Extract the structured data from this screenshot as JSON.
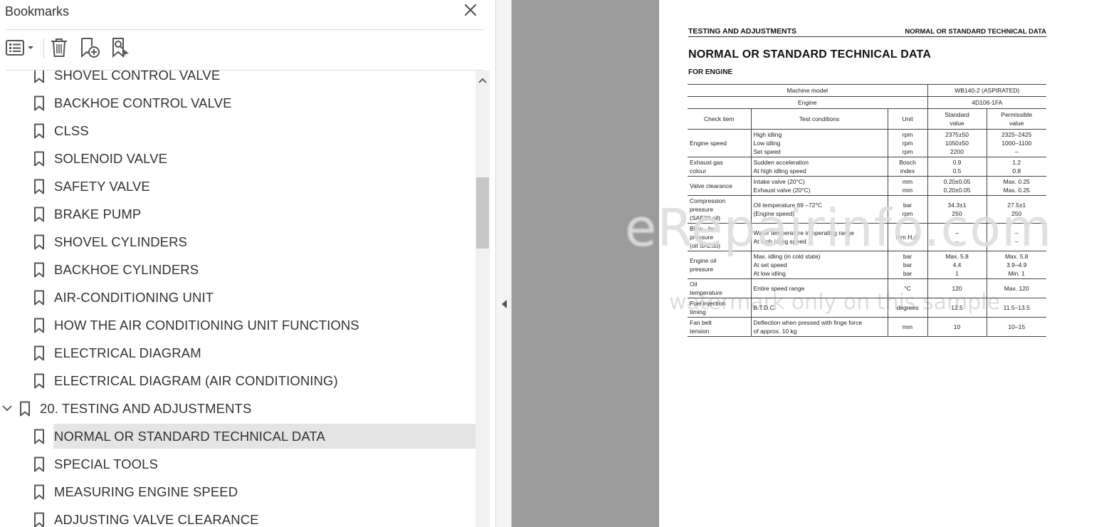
{
  "panel": {
    "title": "Bookmarks",
    "close_icon": "close-icon",
    "toolbar": {
      "options_icon": "list-options-icon",
      "delete_icon": "trash-icon",
      "new_bookmark_icon": "new-bookmark-icon",
      "find_bookmark_icon": "find-current-bookmark-icon"
    }
  },
  "bookmarks": [
    {
      "label": "SHOVEL CONTROL VALVE",
      "level": "child"
    },
    {
      "label": "BACKHOE CONTROL VALVE",
      "level": "child"
    },
    {
      "label": "CLSS",
      "level": "child"
    },
    {
      "label": "SOLENOID VALVE",
      "level": "child"
    },
    {
      "label": "SAFETY VALVE",
      "level": "child"
    },
    {
      "label": "BRAKE PUMP",
      "level": "child"
    },
    {
      "label": "SHOVEL CYLINDERS",
      "level": "child"
    },
    {
      "label": "BACKHOE CYLINDERS",
      "level": "child"
    },
    {
      "label": "AIR-CONDITIONING UNIT",
      "level": "child"
    },
    {
      "label": "HOW THE AIR CONDITIONING UNIT FUNCTIONS",
      "level": "child"
    },
    {
      "label": "ELECTRICAL DIAGRAM",
      "level": "child"
    },
    {
      "label": "ELECTRICAL DIAGRAM (AIR CONDITIONING)",
      "level": "child"
    },
    {
      "label": "20. TESTING AND ADJUSTMENTS",
      "level": "parent",
      "expanded": true
    },
    {
      "label": "NORMAL OR STANDARD TECHNICAL DATA",
      "level": "child",
      "selected": true
    },
    {
      "label": "SPECIAL TOOLS",
      "level": "child"
    },
    {
      "label": "MEASURING ENGINE SPEED",
      "level": "child"
    },
    {
      "label": "ADJUSTING VALVE CLEARANCE",
      "level": "child"
    }
  ],
  "document": {
    "header_left": "TESTING AND ADJUSTMENTS",
    "header_right": "NORMAL OR STANDARD TECHNICAL DATA",
    "title": "NORMAL OR STANDARD TECHNICAL DATA",
    "subtitle": "FOR ENGINE",
    "table": {
      "machine_model_label": "Machine model",
      "machine_model_value": "WB140-2 (ASPIRATED)",
      "engine_label": "Engine",
      "engine_value": "4D106-1FA",
      "col_check_item": "Check item",
      "col_test_conditions": "Test conditions",
      "col_unit": "Unit",
      "col_standard": "Standard\nvalue",
      "col_permissible": "Permissible\nvalue",
      "rows": [
        {
          "item": "Engine speed",
          "conditions": "High idling\nLow idling\nSet speed",
          "unit": "rpm\nrpm\nrpm",
          "standard": "2375±50\n1050±50\n2200",
          "permissible": "2325–2425\n1000–1100\n–"
        },
        {
          "item": "Exhaust gas\ncolour",
          "conditions": "Sudden acceleration\nAt high idling speed",
          "unit": "Bosch\nindex",
          "standard": "0.9\n0.5",
          "permissible": "1.2\n0.8"
        },
        {
          "item": "Valve clearance",
          "conditions": "Intake valve (20°C)\nExhaust valve (20°C)",
          "unit": "mm\nmm",
          "standard": "0.20±0.05\n0.20±0.05",
          "permissible": "Max. 0.25\nMax. 0.25"
        },
        {
          "item": "Compression\npressure\n(SAE30 oil)",
          "conditions": "Oil temperature 69 –72°C\n(Engine speed)",
          "unit": "bar\nrpm",
          "standard": "34.3±1\n250",
          "permissible": "27.5±1\n250"
        },
        {
          "item": "Blow - by\npressure\n(oil SAE30)",
          "conditions": "Water temperature in operating range\nAt high idling speed",
          "unit": "mm H₂O",
          "standard": "–\n–",
          "permissible": "–\n–"
        },
        {
          "item": "Engine oil\npressure",
          "conditions": "Max. idling (in cold state)\nAt set speed\nAt low idling",
          "unit": "bar\nbar\nbar",
          "standard": "Max. 5.8\n4.4\n1",
          "permissible": "Max. 5.8\n3.9–4.9\nMin. 1"
        },
        {
          "item": "Oil\ntemperature",
          "conditions": "Entire speed range",
          "unit": "°C",
          "standard": "120",
          "permissible": "Max. 120"
        },
        {
          "item": "Fuel injection\ntiming",
          "conditions": "B.T.D.C.",
          "unit": "degrees",
          "standard": "12.5",
          "permissible": "11.5–13.5"
        },
        {
          "item": "Fan belt\ntension",
          "conditions": "Deflection when pressed with finge force\nof approx. 10 kg",
          "unit": "mm",
          "standard": "10",
          "permissible": "10–15"
        }
      ]
    },
    "watermark": "eRepairinfo.com",
    "watermark_sub": "watermark only on this sample"
  }
}
